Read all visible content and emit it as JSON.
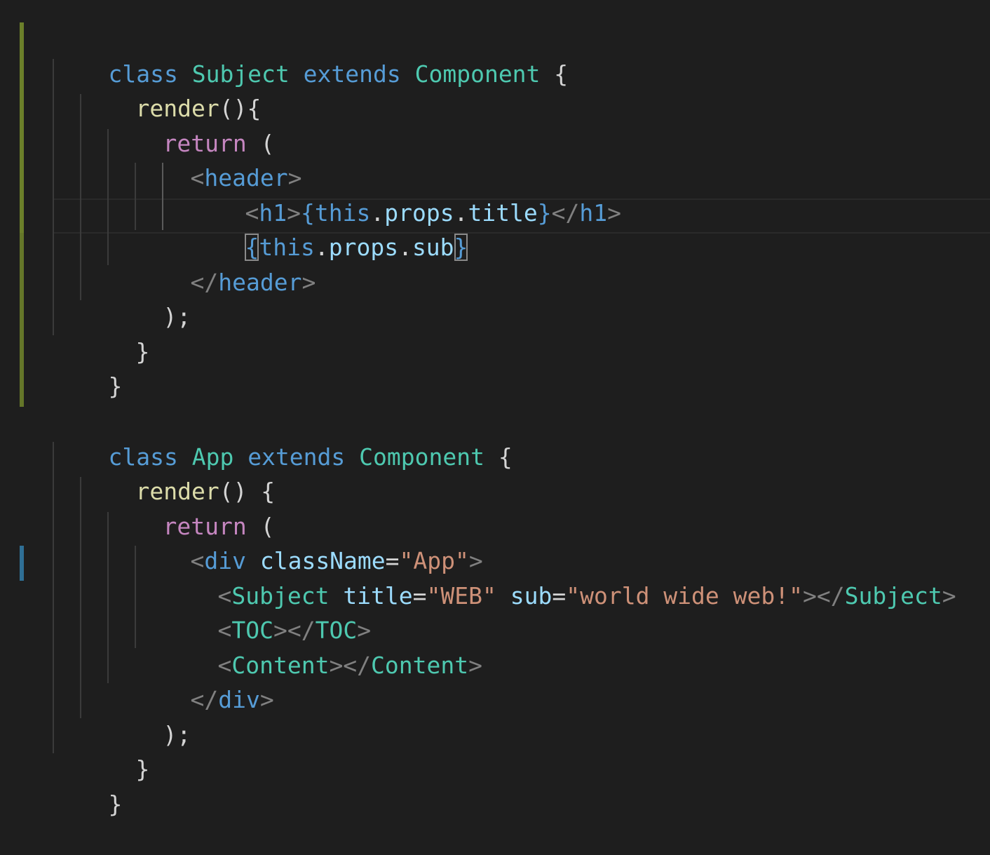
{
  "colors": {
    "background": "#1e1e1e",
    "keyword": "#569cd6",
    "class_name": "#4ec9b0",
    "function": "#dcdcaa",
    "control": "#c586c0",
    "attribute": "#9cdcfe",
    "string": "#ce9178",
    "modified_marker": "#6b7f2a",
    "added_marker": "#2f6f95"
  },
  "code": {
    "l1": {
      "kw_class": "class",
      "name": "Subject",
      "kw_extends": "extends",
      "base": "Component",
      "brace": "{"
    },
    "l2": {
      "fn": "render",
      "punct": "(){"
    },
    "l3": {
      "kw": "return",
      "punct": "("
    },
    "l4": {
      "open": "<",
      "tag": "header",
      "close": ">"
    },
    "l5": {
      "open": "<",
      "tag": "h1",
      "close": ">",
      "lb": "{",
      "this": "this",
      "dot1": ".",
      "props": "props",
      "dot2": ".",
      "prop": "title",
      "rb": "}",
      "open2": "</",
      "tag2": "h1",
      "close2": ">"
    },
    "l6": {
      "lb": "{",
      "this": "this",
      "dot1": ".",
      "props": "props",
      "dot2": ".",
      "prop": "sub",
      "rb": "}"
    },
    "l7": {
      "open": "</",
      "tag": "header",
      "close": ">"
    },
    "l8": {
      "punct": ");"
    },
    "l9": {
      "punct": "}"
    },
    "l10": {
      "punct": "}"
    },
    "l11": {
      "kw_class": "class",
      "name": "App",
      "kw_extends": "extends",
      "base": "Component",
      "brace": "{"
    },
    "l12": {
      "fn": "render",
      "punct": "() {"
    },
    "l13": {
      "kw": "return",
      "punct": "("
    },
    "l14": {
      "open": "<",
      "tag": "div",
      "attr": "className",
      "eq": "=",
      "str": "\"App\"",
      "close": ">"
    },
    "l15": {
      "open": "<",
      "tag": "Subject",
      "attr1": "title",
      "eq1": "=",
      "str1": "\"WEB\"",
      "attr2": "sub",
      "eq2": "=",
      "str2": "\"world wide web!\"",
      "mid": "></",
      "tag2": "Subject",
      "close": ">"
    },
    "l16": {
      "open": "<",
      "tag": "TOC",
      "mid": "></",
      "tag2": "TOC",
      "close": ">"
    },
    "l17": {
      "open": "<",
      "tag": "Content",
      "mid": "></",
      "tag2": "Content",
      "close": ">"
    },
    "l18": {
      "open": "</",
      "tag": "div",
      "close": ">"
    },
    "l19": {
      "punct": ");"
    },
    "l20": {
      "punct": "}"
    },
    "l21": {
      "punct": "}"
    }
  }
}
